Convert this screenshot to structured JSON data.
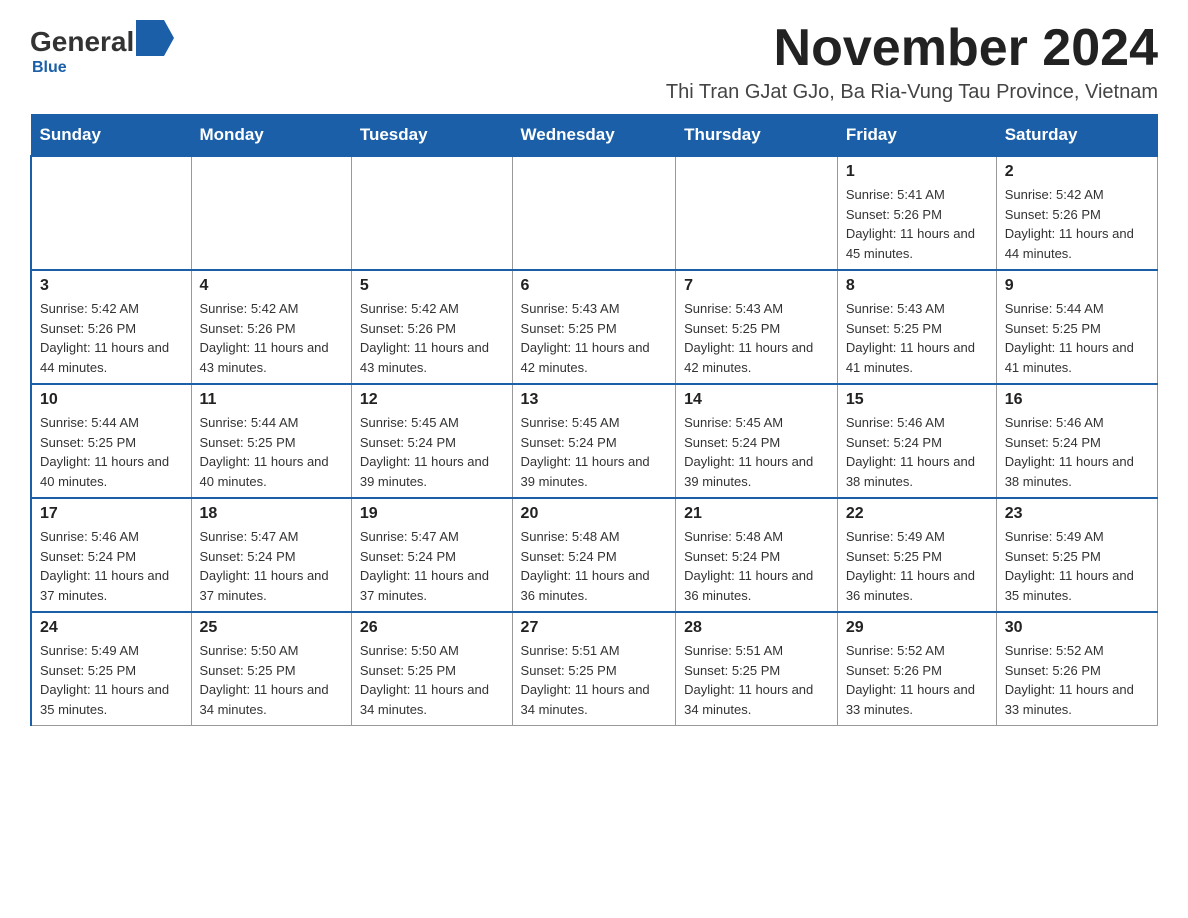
{
  "logo": {
    "general": "General",
    "blue": "Blue",
    "tagline": "Blue"
  },
  "title": "November 2024",
  "subtitle": "Thi Tran GJat GJo, Ba Ria-Vung Tau Province, Vietnam",
  "days_of_week": [
    "Sunday",
    "Monday",
    "Tuesday",
    "Wednesday",
    "Thursday",
    "Friday",
    "Saturday"
  ],
  "weeks": [
    [
      {
        "day": "",
        "info": ""
      },
      {
        "day": "",
        "info": ""
      },
      {
        "day": "",
        "info": ""
      },
      {
        "day": "",
        "info": ""
      },
      {
        "day": "",
        "info": ""
      },
      {
        "day": "1",
        "info": "Sunrise: 5:41 AM\nSunset: 5:26 PM\nDaylight: 11 hours and 45 minutes."
      },
      {
        "day": "2",
        "info": "Sunrise: 5:42 AM\nSunset: 5:26 PM\nDaylight: 11 hours and 44 minutes."
      }
    ],
    [
      {
        "day": "3",
        "info": "Sunrise: 5:42 AM\nSunset: 5:26 PM\nDaylight: 11 hours and 44 minutes."
      },
      {
        "day": "4",
        "info": "Sunrise: 5:42 AM\nSunset: 5:26 PM\nDaylight: 11 hours and 43 minutes."
      },
      {
        "day": "5",
        "info": "Sunrise: 5:42 AM\nSunset: 5:26 PM\nDaylight: 11 hours and 43 minutes."
      },
      {
        "day": "6",
        "info": "Sunrise: 5:43 AM\nSunset: 5:25 PM\nDaylight: 11 hours and 42 minutes."
      },
      {
        "day": "7",
        "info": "Sunrise: 5:43 AM\nSunset: 5:25 PM\nDaylight: 11 hours and 42 minutes."
      },
      {
        "day": "8",
        "info": "Sunrise: 5:43 AM\nSunset: 5:25 PM\nDaylight: 11 hours and 41 minutes."
      },
      {
        "day": "9",
        "info": "Sunrise: 5:44 AM\nSunset: 5:25 PM\nDaylight: 11 hours and 41 minutes."
      }
    ],
    [
      {
        "day": "10",
        "info": "Sunrise: 5:44 AM\nSunset: 5:25 PM\nDaylight: 11 hours and 40 minutes."
      },
      {
        "day": "11",
        "info": "Sunrise: 5:44 AM\nSunset: 5:25 PM\nDaylight: 11 hours and 40 minutes."
      },
      {
        "day": "12",
        "info": "Sunrise: 5:45 AM\nSunset: 5:24 PM\nDaylight: 11 hours and 39 minutes."
      },
      {
        "day": "13",
        "info": "Sunrise: 5:45 AM\nSunset: 5:24 PM\nDaylight: 11 hours and 39 minutes."
      },
      {
        "day": "14",
        "info": "Sunrise: 5:45 AM\nSunset: 5:24 PM\nDaylight: 11 hours and 39 minutes."
      },
      {
        "day": "15",
        "info": "Sunrise: 5:46 AM\nSunset: 5:24 PM\nDaylight: 11 hours and 38 minutes."
      },
      {
        "day": "16",
        "info": "Sunrise: 5:46 AM\nSunset: 5:24 PM\nDaylight: 11 hours and 38 minutes."
      }
    ],
    [
      {
        "day": "17",
        "info": "Sunrise: 5:46 AM\nSunset: 5:24 PM\nDaylight: 11 hours and 37 minutes."
      },
      {
        "day": "18",
        "info": "Sunrise: 5:47 AM\nSunset: 5:24 PM\nDaylight: 11 hours and 37 minutes."
      },
      {
        "day": "19",
        "info": "Sunrise: 5:47 AM\nSunset: 5:24 PM\nDaylight: 11 hours and 37 minutes."
      },
      {
        "day": "20",
        "info": "Sunrise: 5:48 AM\nSunset: 5:24 PM\nDaylight: 11 hours and 36 minutes."
      },
      {
        "day": "21",
        "info": "Sunrise: 5:48 AM\nSunset: 5:24 PM\nDaylight: 11 hours and 36 minutes."
      },
      {
        "day": "22",
        "info": "Sunrise: 5:49 AM\nSunset: 5:25 PM\nDaylight: 11 hours and 36 minutes."
      },
      {
        "day": "23",
        "info": "Sunrise: 5:49 AM\nSunset: 5:25 PM\nDaylight: 11 hours and 35 minutes."
      }
    ],
    [
      {
        "day": "24",
        "info": "Sunrise: 5:49 AM\nSunset: 5:25 PM\nDaylight: 11 hours and 35 minutes."
      },
      {
        "day": "25",
        "info": "Sunrise: 5:50 AM\nSunset: 5:25 PM\nDaylight: 11 hours and 34 minutes."
      },
      {
        "day": "26",
        "info": "Sunrise: 5:50 AM\nSunset: 5:25 PM\nDaylight: 11 hours and 34 minutes."
      },
      {
        "day": "27",
        "info": "Sunrise: 5:51 AM\nSunset: 5:25 PM\nDaylight: 11 hours and 34 minutes."
      },
      {
        "day": "28",
        "info": "Sunrise: 5:51 AM\nSunset: 5:25 PM\nDaylight: 11 hours and 34 minutes."
      },
      {
        "day": "29",
        "info": "Sunrise: 5:52 AM\nSunset: 5:26 PM\nDaylight: 11 hours and 33 minutes."
      },
      {
        "day": "30",
        "info": "Sunrise: 5:52 AM\nSunset: 5:26 PM\nDaylight: 11 hours and 33 minutes."
      }
    ]
  ]
}
